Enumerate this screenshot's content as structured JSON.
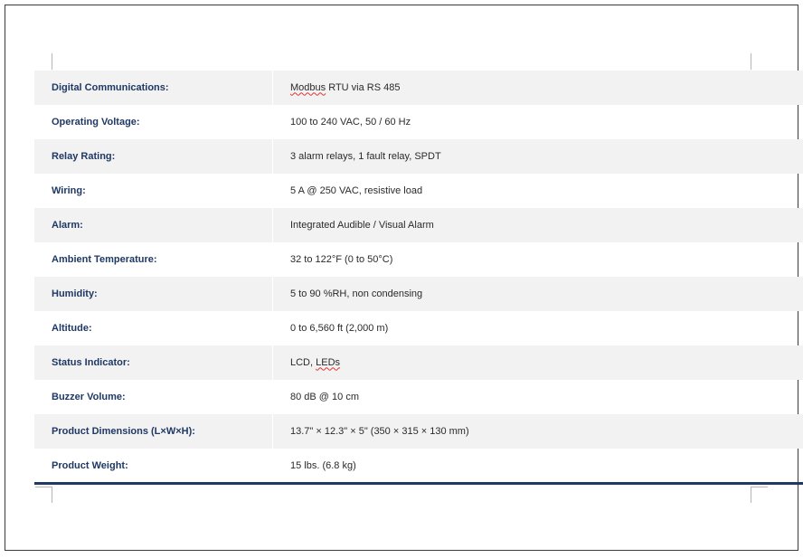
{
  "specs": [
    {
      "label": "Digital Communications:",
      "value": "Modbus RTU via RS 485"
    },
    {
      "label": "Operating Voltage:",
      "value": "100 to 240 VAC, 50 / 60 Hz"
    },
    {
      "label": "Relay Rating:",
      "value": "3 alarm relays, 1 fault relay, SPDT"
    },
    {
      "label": "Wiring:",
      "value": "5 A @ 250 VAC, resistive load"
    },
    {
      "label": "Alarm:",
      "value": "Integrated Audible / Visual Alarm"
    },
    {
      "label": "Ambient Temperature:",
      "value": "32 to 122°F (0 to 50°C)"
    },
    {
      "label": "Humidity:",
      "value": "5 to 90 %RH, non condensing"
    },
    {
      "label": "Altitude:",
      "value": "0 to 6,560 ft (2,000 m)"
    },
    {
      "label": "Status Indicator:",
      "value": "LCD, LEDs"
    },
    {
      "label": "Buzzer Volume:",
      "value": "80 dB @ 10 cm"
    },
    {
      "label": "Product Dimensions (L×W×H):",
      "value": "13.7\" × 12.3\" × 5\" (350 × 315 × 130 mm)"
    },
    {
      "label": "Product Weight:",
      "value": "15 lbs. (6.8 kg)"
    }
  ],
  "colors": {
    "label_text": "#1f3864",
    "row_shade": "#f2f2f2",
    "rule": "#1f3864"
  }
}
